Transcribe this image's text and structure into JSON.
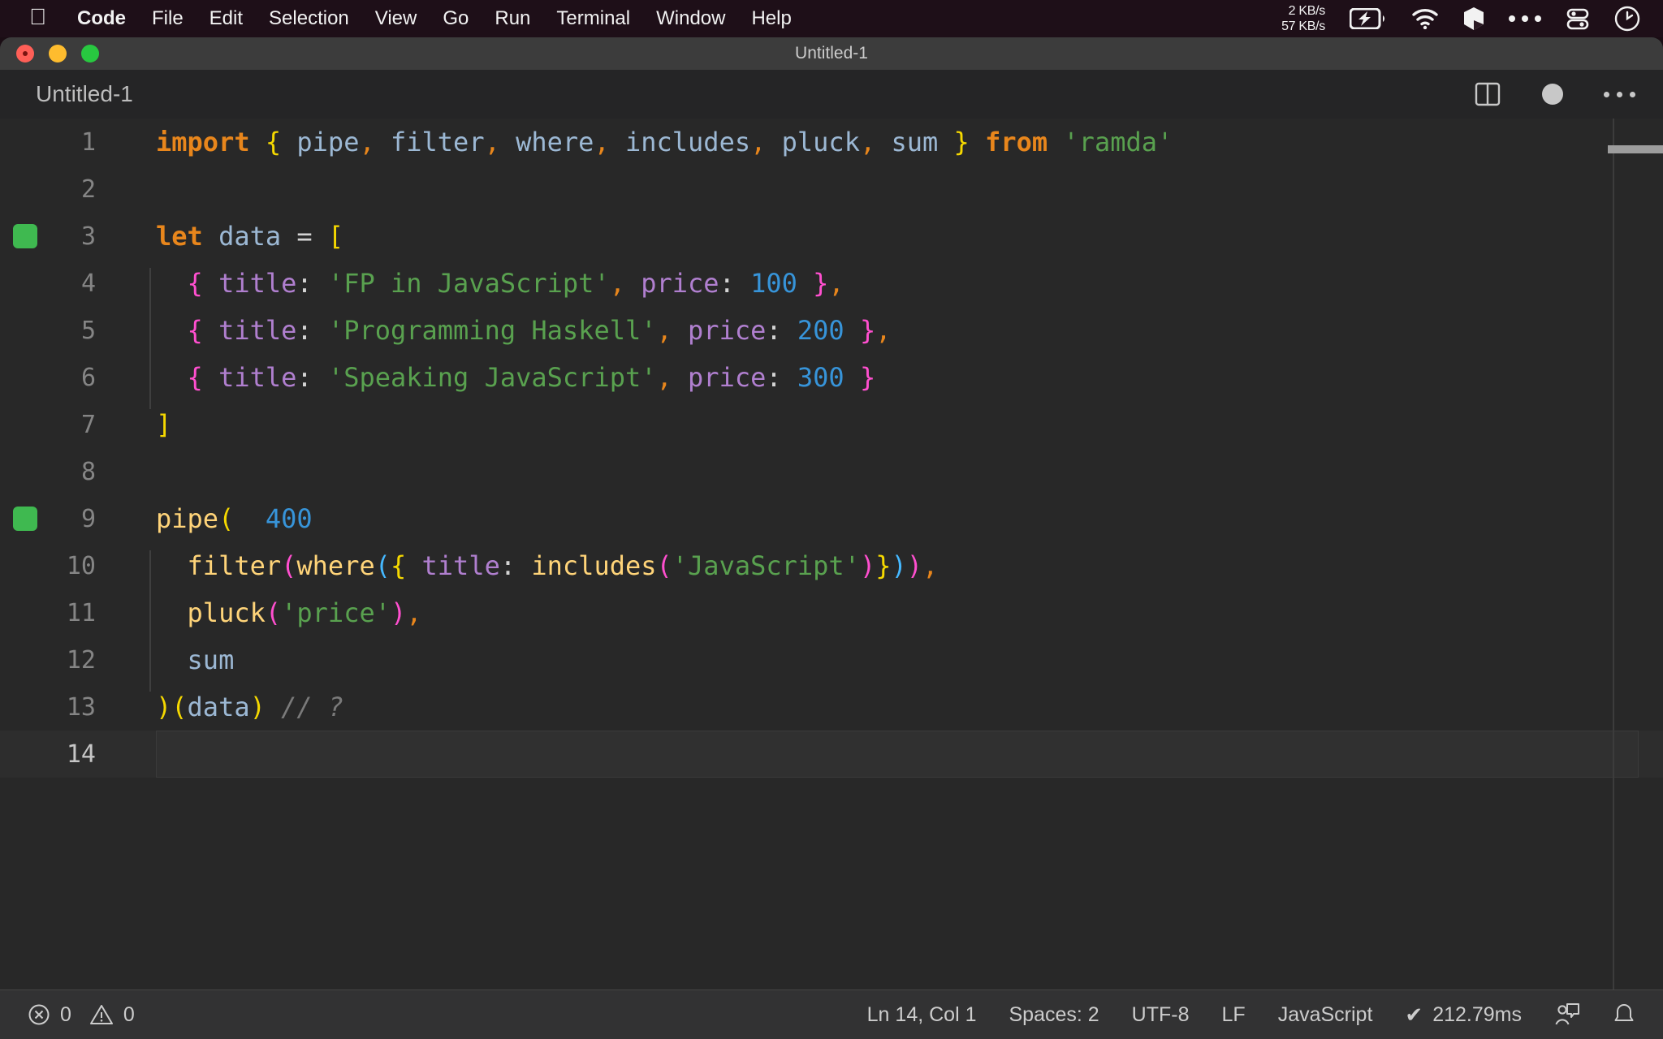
{
  "menubar": {
    "apple_icon": "apple-logo-icon",
    "items": [
      {
        "label": "Code",
        "bold": true
      },
      {
        "label": "File",
        "bold": false
      },
      {
        "label": "Edit",
        "bold": false
      },
      {
        "label": "Selection",
        "bold": false
      },
      {
        "label": "View",
        "bold": false
      },
      {
        "label": "Go",
        "bold": false
      },
      {
        "label": "Run",
        "bold": false
      },
      {
        "label": "Terminal",
        "bold": false
      },
      {
        "label": "Window",
        "bold": false
      },
      {
        "label": "Help",
        "bold": false
      }
    ],
    "status": {
      "network_up": "2 KB/s",
      "network_down": "57 KB/s",
      "battery_icon": "battery-charging-icon",
      "wifi_icon": "wifi-icon",
      "cube_icon": "cube-icon",
      "ellipsis_icon": "ellipsis-icon",
      "control_center_icon": "control-center-icon",
      "clock_icon": "clock-icon"
    }
  },
  "window": {
    "title": "Untitled-1",
    "traffic_lights": [
      "close",
      "minimize",
      "zoom"
    ]
  },
  "editor": {
    "tab_label": "Untitled-1",
    "actions": {
      "split_editor": "split-editor-icon",
      "unsaved_indicator": "unsaved-dot-icon",
      "more_actions": "more-actions-icon"
    },
    "language": "JavaScript",
    "lines": [
      {
        "number": "1",
        "marker": false,
        "indent_guide": false,
        "tokens": [
          {
            "t": "import",
            "c": "t-kw"
          },
          {
            "t": " ",
            "c": "t-op"
          },
          {
            "t": "{",
            "c": "b-yellow"
          },
          {
            "t": " pipe",
            "c": "t-varblue"
          },
          {
            "t": ",",
            "c": "t-comma"
          },
          {
            "t": " filter",
            "c": "t-varblue"
          },
          {
            "t": ",",
            "c": "t-comma"
          },
          {
            "t": " where",
            "c": "t-varblue"
          },
          {
            "t": ",",
            "c": "t-comma"
          },
          {
            "t": " includes",
            "c": "t-varblue"
          },
          {
            "t": ",",
            "c": "t-comma"
          },
          {
            "t": " pluck",
            "c": "t-varblue"
          },
          {
            "t": ",",
            "c": "t-comma"
          },
          {
            "t": " sum ",
            "c": "t-varblue"
          },
          {
            "t": "}",
            "c": "b-yellow"
          },
          {
            "t": " ",
            "c": "t-op"
          },
          {
            "t": "from",
            "c": "t-kw"
          },
          {
            "t": " ",
            "c": "t-op"
          },
          {
            "t": "'ramda'",
            "c": "t-strg"
          }
        ]
      },
      {
        "number": "2",
        "marker": false,
        "indent_guide": false,
        "tokens": []
      },
      {
        "number": "3",
        "marker": true,
        "indent_guide": false,
        "tokens": [
          {
            "t": "let",
            "c": "t-kw"
          },
          {
            "t": " ",
            "c": "t-op"
          },
          {
            "t": "data",
            "c": "t-varblue"
          },
          {
            "t": " ",
            "c": "t-op"
          },
          {
            "t": "=",
            "c": "t-op"
          },
          {
            "t": " ",
            "c": "t-op"
          },
          {
            "t": "[",
            "c": "b-yellow"
          }
        ]
      },
      {
        "number": "4",
        "marker": false,
        "indent_guide": true,
        "tokens": [
          {
            "t": "  ",
            "c": "t-op"
          },
          {
            "t": "{",
            "c": "b-pink"
          },
          {
            "t": " ",
            "c": "t-op"
          },
          {
            "t": "title",
            "c": "t-prop"
          },
          {
            "t": ":",
            "c": "t-op"
          },
          {
            "t": " ",
            "c": "t-op"
          },
          {
            "t": "'FP in JavaScript'",
            "c": "t-strg"
          },
          {
            "t": ",",
            "c": "t-comma"
          },
          {
            "t": " ",
            "c": "t-op"
          },
          {
            "t": "price",
            "c": "t-prop"
          },
          {
            "t": ":",
            "c": "t-op"
          },
          {
            "t": " ",
            "c": "t-op"
          },
          {
            "t": "100",
            "c": "t-num"
          },
          {
            "t": " ",
            "c": "t-op"
          },
          {
            "t": "}",
            "c": "b-pink"
          },
          {
            "t": ",",
            "c": "t-comma"
          }
        ]
      },
      {
        "number": "5",
        "marker": false,
        "indent_guide": true,
        "tokens": [
          {
            "t": "  ",
            "c": "t-op"
          },
          {
            "t": "{",
            "c": "b-pink"
          },
          {
            "t": " ",
            "c": "t-op"
          },
          {
            "t": "title",
            "c": "t-prop"
          },
          {
            "t": ":",
            "c": "t-op"
          },
          {
            "t": " ",
            "c": "t-op"
          },
          {
            "t": "'Programming Haskell'",
            "c": "t-strg"
          },
          {
            "t": ",",
            "c": "t-comma"
          },
          {
            "t": " ",
            "c": "t-op"
          },
          {
            "t": "price",
            "c": "t-prop"
          },
          {
            "t": ":",
            "c": "t-op"
          },
          {
            "t": " ",
            "c": "t-op"
          },
          {
            "t": "200",
            "c": "t-num"
          },
          {
            "t": " ",
            "c": "t-op"
          },
          {
            "t": "}",
            "c": "b-pink"
          },
          {
            "t": ",",
            "c": "t-comma"
          }
        ]
      },
      {
        "number": "6",
        "marker": false,
        "indent_guide": true,
        "tokens": [
          {
            "t": "  ",
            "c": "t-op"
          },
          {
            "t": "{",
            "c": "b-pink"
          },
          {
            "t": " ",
            "c": "t-op"
          },
          {
            "t": "title",
            "c": "t-prop"
          },
          {
            "t": ":",
            "c": "t-op"
          },
          {
            "t": " ",
            "c": "t-op"
          },
          {
            "t": "'Speaking JavaScript'",
            "c": "t-strg"
          },
          {
            "t": ",",
            "c": "t-comma"
          },
          {
            "t": " ",
            "c": "t-op"
          },
          {
            "t": "price",
            "c": "t-prop"
          },
          {
            "t": ":",
            "c": "t-op"
          },
          {
            "t": " ",
            "c": "t-op"
          },
          {
            "t": "300",
            "c": "t-num"
          },
          {
            "t": " ",
            "c": "t-op"
          },
          {
            "t": "}",
            "c": "b-pink"
          }
        ]
      },
      {
        "number": "7",
        "marker": false,
        "indent_guide": false,
        "tokens": [
          {
            "t": "]",
            "c": "b-yellow"
          }
        ]
      },
      {
        "number": "8",
        "marker": false,
        "indent_guide": false,
        "tokens": []
      },
      {
        "number": "9",
        "marker": true,
        "indent_guide": false,
        "tokens": [
          {
            "t": "pipe",
            "c": "t-fn"
          },
          {
            "t": "(",
            "c": "b-yellow"
          },
          {
            "t": "  ",
            "c": "t-op"
          },
          {
            "t": "400",
            "c": "t-hint"
          }
        ]
      },
      {
        "number": "10",
        "marker": false,
        "indent_guide": true,
        "tokens": [
          {
            "t": "  ",
            "c": "t-op"
          },
          {
            "t": "filter",
            "c": "t-fn"
          },
          {
            "t": "(",
            "c": "b-pink"
          },
          {
            "t": "where",
            "c": "t-fn"
          },
          {
            "t": "(",
            "c": "b-blue"
          },
          {
            "t": "{",
            "c": "b-yellow"
          },
          {
            "t": " ",
            "c": "t-op"
          },
          {
            "t": "title",
            "c": "t-prop"
          },
          {
            "t": ":",
            "c": "t-op"
          },
          {
            "t": " ",
            "c": "t-op"
          },
          {
            "t": "includes",
            "c": "t-fn"
          },
          {
            "t": "(",
            "c": "b-pink"
          },
          {
            "t": "'JavaScript'",
            "c": "t-strg"
          },
          {
            "t": ")",
            "c": "b-pink"
          },
          {
            "t": "}",
            "c": "b-yellow"
          },
          {
            "t": ")",
            "c": "b-blue"
          },
          {
            "t": ")",
            "c": "b-pink"
          },
          {
            "t": ",",
            "c": "t-comma"
          }
        ]
      },
      {
        "number": "11",
        "marker": false,
        "indent_guide": true,
        "tokens": [
          {
            "t": "  ",
            "c": "t-op"
          },
          {
            "t": "pluck",
            "c": "t-fn"
          },
          {
            "t": "(",
            "c": "b-pink"
          },
          {
            "t": "'price'",
            "c": "t-strg"
          },
          {
            "t": ")",
            "c": "b-pink"
          },
          {
            "t": ",",
            "c": "t-comma"
          }
        ]
      },
      {
        "number": "12",
        "marker": false,
        "indent_guide": true,
        "tokens": [
          {
            "t": "  ",
            "c": "t-op"
          },
          {
            "t": "sum",
            "c": "t-varblue"
          }
        ]
      },
      {
        "number": "13",
        "marker": false,
        "indent_guide": false,
        "tokens": [
          {
            "t": ")",
            "c": "b-yellow"
          },
          {
            "t": "(",
            "c": "b-yellow"
          },
          {
            "t": "data",
            "c": "t-varblue"
          },
          {
            "t": ")",
            "c": "b-yellow"
          },
          {
            "t": " ",
            "c": "t-op"
          },
          {
            "t": "// ?",
            "c": "t-comment"
          }
        ]
      },
      {
        "number": "14",
        "marker": false,
        "indent_guide": false,
        "current": true,
        "tokens": []
      }
    ]
  },
  "statusbar": {
    "errors_icon": "error-circle-icon",
    "errors_count": "0",
    "warnings_icon": "warning-triangle-icon",
    "warnings_count": "0",
    "cursor_position": "Ln 14, Col 1",
    "indentation": "Spaces: 2",
    "encoding": "UTF-8",
    "eol": "LF",
    "language_mode": "JavaScript",
    "run_status_icon": "checkmark-icon",
    "run_time": "212.79ms",
    "feedback_icon": "feedback-icon",
    "notifications_icon": "bell-icon"
  },
  "colors": {
    "menubar_bg": "#1e0f18",
    "titlebar_bg": "#3c3c3c",
    "tabrow_bg": "#252526",
    "editor_bg": "#282828",
    "statusbar_bg": "#323233",
    "gutter_marker": "#3fb950"
  }
}
